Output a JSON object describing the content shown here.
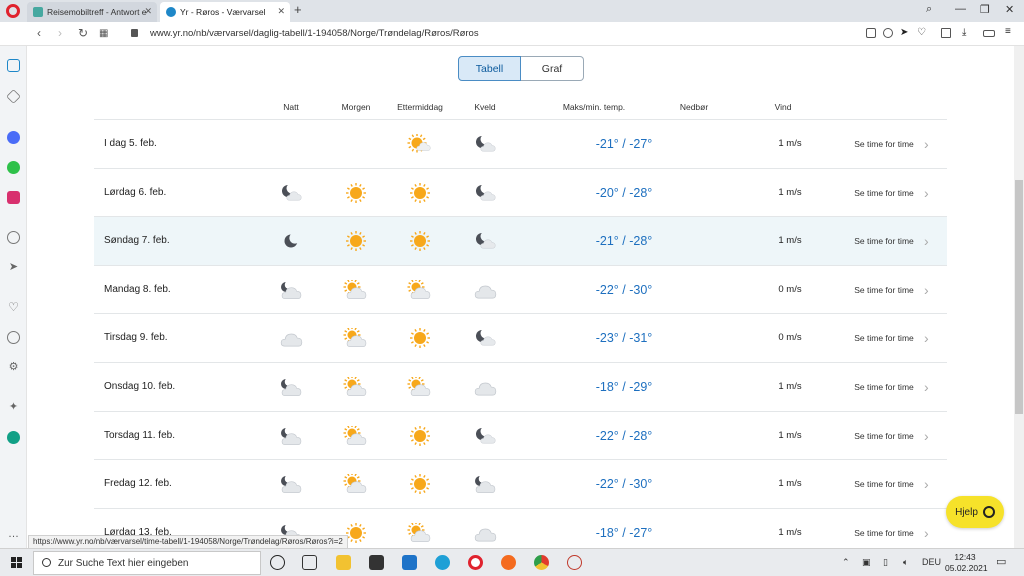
{
  "browser": {
    "tabs": [
      {
        "label": "Reisemobiltreff - Antwort e"
      },
      {
        "label": "Yr - Røros - Værvarsel"
      }
    ],
    "url": "www.yr.no/nb/værvarsel/daglig-tabell/1-194058/Norge/Trøndelag/Røros/Røros",
    "status_link": "https://www.yr.no/nb/værvarsel/time-tabell/1-194058/Norge/Trøndelag/Røros/Røros?i=2"
  },
  "view_toggle": {
    "tabell": "Tabell",
    "graf": "Graf",
    "selected": "Tabell"
  },
  "headers": {
    "natt": "Natt",
    "morgen": "Morgen",
    "ettermiddag": "Ettermiddag",
    "kveld": "Kveld",
    "temp": "Maks/min. temp.",
    "nedbor": "Nedbør",
    "vind": "Vind"
  },
  "rows": [
    {
      "day": "I dag 5. feb.",
      "icons": [
        "",
        "",
        "sun-partly-cloudy",
        "moon-cloud"
      ],
      "temp": "-21° / -27°",
      "wind": "1 m/s",
      "link": "Se time for time"
    },
    {
      "day": "Lørdag 6. feb.",
      "icons": [
        "moon-cloud",
        "sun",
        "sun",
        "moon-cloud"
      ],
      "temp": "-20° / -28°",
      "wind": "1 m/s",
      "link": "Se time for time"
    },
    {
      "day": "Søndag 7. feb.",
      "icons": [
        "moon",
        "sun",
        "sun",
        "moon-cloud"
      ],
      "temp": "-21° / -28°",
      "wind": "1 m/s",
      "link": "Se time for time"
    },
    {
      "day": "Mandag 8. feb.",
      "icons": [
        "moon-cloud-heavy",
        "sun-cloud-heavy",
        "sun-cloud-heavy",
        "cloud"
      ],
      "temp": "-22° / -30°",
      "wind": "0 m/s",
      "link": "Se time for time"
    },
    {
      "day": "Tirsdag 9. feb.",
      "icons": [
        "cloud",
        "sun-cloud-heavy",
        "sun",
        "moon-cloud"
      ],
      "temp": "-23° / -31°",
      "wind": "0 m/s",
      "link": "Se time for time"
    },
    {
      "day": "Onsdag 10. feb.",
      "icons": [
        "moon-cloud-heavy",
        "sun-cloud-heavy",
        "sun-cloud-heavy",
        "cloud"
      ],
      "temp": "-18° / -29°",
      "wind": "1 m/s",
      "link": "Se time for time"
    },
    {
      "day": "Torsdag 11. feb.",
      "icons": [
        "moon-cloud-heavy",
        "sun-cloud-heavy",
        "sun",
        "moon-cloud"
      ],
      "temp": "-22° / -28°",
      "wind": "1 m/s",
      "link": "Se time for time"
    },
    {
      "day": "Fredag 12. feb.",
      "icons": [
        "moon-cloud-heavy",
        "sun-cloud-heavy",
        "sun",
        "moon-cloud-heavy"
      ],
      "temp": "-22° / -30°",
      "wind": "1 m/s",
      "link": "Se time for time"
    },
    {
      "day": "Lørdag 13. feb.",
      "icons": [
        "moon-cloud-heavy",
        "sun",
        "sun-cloud-heavy",
        "cloud"
      ],
      "temp": "-18° / -27°",
      "wind": "1 m/s",
      "link": "Se time for time"
    }
  ],
  "help_button": "Hjelp",
  "taskbar": {
    "search_placeholder": "Zur Suche Text hier eingeben",
    "language": "DEU",
    "time": "12:43",
    "date": "05.02.2021"
  },
  "colors": {
    "accent": "#1d6fbf",
    "sun": "#f7a81b",
    "help": "#f6e22a"
  }
}
